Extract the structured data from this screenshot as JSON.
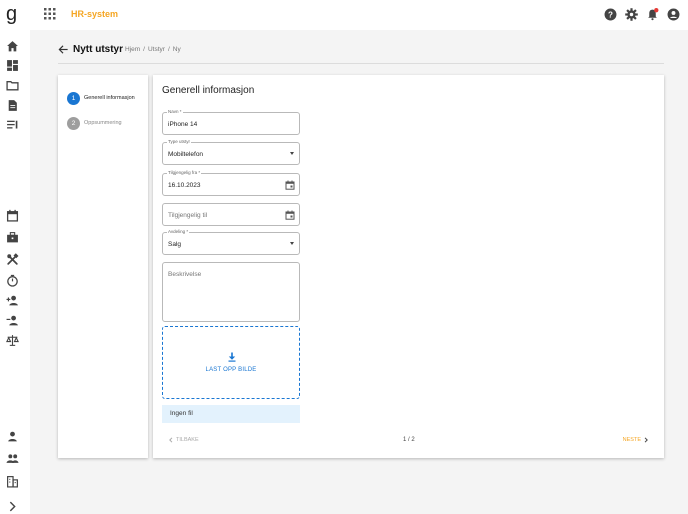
{
  "app": {
    "title": "HR-system"
  },
  "header": {
    "title": "Nytt utstyr",
    "breadcrumb": [
      "Hjem",
      "Utstyr",
      "Ny"
    ],
    "separator": "/"
  },
  "topbar": {
    "icons": [
      "help-icon",
      "settings-icon",
      "notifications-icon",
      "account-icon"
    ],
    "notification_dot_color": "#e53935"
  },
  "sidebar": {
    "icons": [
      "home-icon",
      "dashboard-icon",
      "folder-icon",
      "document-icon",
      "list-icon",
      "calendar-icon",
      "briefcase-icon",
      "tools-icon",
      "timer-icon",
      "person-add-icon",
      "person-remove-icon",
      "scales-icon",
      "person-icon",
      "group-icon",
      "building-icon",
      "expand-icon"
    ]
  },
  "steps": [
    {
      "number": "1",
      "label": "Generell informasjon",
      "active": true
    },
    {
      "number": "2",
      "label": "Oppsummering",
      "active": false
    }
  ],
  "form": {
    "heading": "Generell informasjon",
    "name": {
      "label": "Navn *",
      "value": "iPhone 14"
    },
    "type": {
      "label": "Type utstyr",
      "value": "Mobiltelefon"
    },
    "available_from": {
      "label": "Tilgjengelig fra *",
      "value": "16.10.2023"
    },
    "available_to": {
      "placeholder": "Tilgjengelig til"
    },
    "department": {
      "label": "Avdeling *",
      "value": "Salg"
    },
    "description": {
      "placeholder": "Beskrivelse"
    },
    "upload_label": "LAST OPP BILDE",
    "file_status": "Ingen fil"
  },
  "navigation": {
    "prev_label": "TILBAKE",
    "page_indicator": "1 / 2",
    "next_label": "NESTE"
  },
  "colors": {
    "accent": "#f5a623",
    "primary": "#1976d2"
  }
}
